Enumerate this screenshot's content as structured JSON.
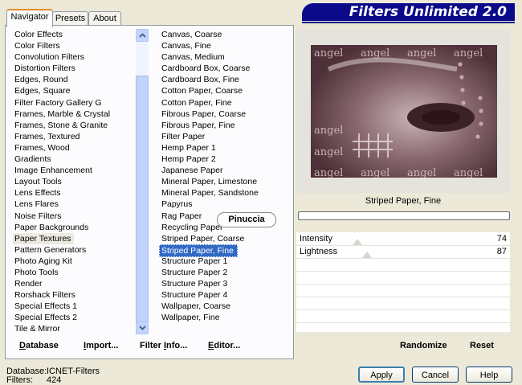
{
  "header": {
    "title": "Filters Unlimited 2.0"
  },
  "tabs": [
    {
      "label": "Navigator",
      "active": true
    },
    {
      "label": "Presets",
      "active": false
    },
    {
      "label": "About",
      "active": false
    }
  ],
  "categories": [
    "Color Effects",
    "Color Filters",
    "Convolution Filters",
    "Distortion Filters",
    "Edges, Round",
    "Edges, Square",
    "Filter Factory Gallery G",
    "Frames, Marble & Crystal",
    "Frames, Stone & Granite",
    "Frames, Textured",
    "Frames, Wood",
    "Gradients",
    "Image Enhancement",
    "Layout Tools",
    "Lens Effects",
    "Lens Flares",
    "Noise Filters",
    "Paper Backgrounds",
    "Paper Textures",
    "Pattern Generators",
    "Photo Aging Kit",
    "Photo Tools",
    "Render",
    "Rorshack Filters",
    "Special Effects 1",
    "Special Effects 2",
    "Tile & Mirror"
  ],
  "selected_category": "Paper Textures",
  "filters": [
    "Canvas, Coarse",
    "Canvas, Fine",
    "Canvas, Medium",
    "Cardboard Box, Coarse",
    "Cardboard Box, Fine",
    "Cotton Paper, Coarse",
    "Cotton Paper, Fine",
    "Fibrous Paper, Coarse",
    "Fibrous Paper, Fine",
    "Filter Paper",
    "Hemp Paper 1",
    "Hemp Paper 2",
    "Japanese Paper",
    "Mineral Paper, Limestone",
    "Mineral Paper, Sandstone",
    "Papyrus",
    "Rag Paper",
    "Recycling Paper",
    "Striped Paper, Coarse",
    "Striped Paper, Fine",
    "Structure Paper 1",
    "Structure Paper 2",
    "Structure Paper 3",
    "Structure Paper 4",
    "Wallpaper, Coarse",
    "Wallpaper, Fine"
  ],
  "selected_filter": "Striped Paper, Fine",
  "watermark": "Pinuccia",
  "preview": {
    "filter_name": "Striped Paper, Fine",
    "image_text": "angel"
  },
  "params": [
    {
      "label": "Intensity",
      "value": "74",
      "fraction": 0.29
    },
    {
      "label": "Lightness",
      "value": "87",
      "fraction": 0.34
    }
  ],
  "panel_buttons": {
    "database": "Database",
    "import": "Import...",
    "filter_info": "Filter Info...",
    "editor": "Editor..."
  },
  "right_buttons": {
    "randomize": "Randomize",
    "reset": "Reset"
  },
  "footer": {
    "database_label": "Database:",
    "database_value": "ICNET-Filters",
    "filters_label": "Filters:",
    "filters_value": "424",
    "apply": "Apply",
    "cancel": "Cancel",
    "help": "Help"
  },
  "colors": {
    "selection": "#316ac5",
    "logo_bg": "#0a0a8a",
    "tab_highlight": "#e68b2c"
  }
}
